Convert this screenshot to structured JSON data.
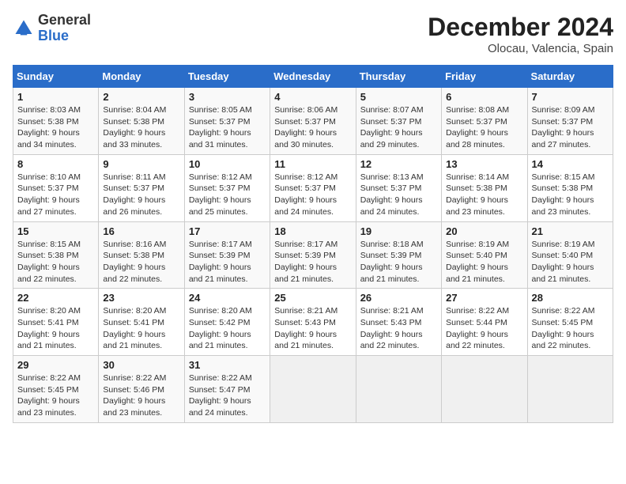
{
  "header": {
    "logo_general": "General",
    "logo_blue": "Blue",
    "title": "December 2024",
    "subtitle": "Olocau, Valencia, Spain"
  },
  "weekdays": [
    "Sunday",
    "Monday",
    "Tuesday",
    "Wednesday",
    "Thursday",
    "Friday",
    "Saturday"
  ],
  "weeks": [
    [
      {
        "day": "1",
        "sunrise": "8:03 AM",
        "sunset": "5:38 PM",
        "daylight": "9 hours and 34 minutes."
      },
      {
        "day": "2",
        "sunrise": "8:04 AM",
        "sunset": "5:38 PM",
        "daylight": "9 hours and 33 minutes."
      },
      {
        "day": "3",
        "sunrise": "8:05 AM",
        "sunset": "5:37 PM",
        "daylight": "9 hours and 31 minutes."
      },
      {
        "day": "4",
        "sunrise": "8:06 AM",
        "sunset": "5:37 PM",
        "daylight": "9 hours and 30 minutes."
      },
      {
        "day": "5",
        "sunrise": "8:07 AM",
        "sunset": "5:37 PM",
        "daylight": "9 hours and 29 minutes."
      },
      {
        "day": "6",
        "sunrise": "8:08 AM",
        "sunset": "5:37 PM",
        "daylight": "9 hours and 28 minutes."
      },
      {
        "day": "7",
        "sunrise": "8:09 AM",
        "sunset": "5:37 PM",
        "daylight": "9 hours and 27 minutes."
      }
    ],
    [
      {
        "day": "8",
        "sunrise": "8:10 AM",
        "sunset": "5:37 PM",
        "daylight": "9 hours and 27 minutes."
      },
      {
        "day": "9",
        "sunrise": "8:11 AM",
        "sunset": "5:37 PM",
        "daylight": "9 hours and 26 minutes."
      },
      {
        "day": "10",
        "sunrise": "8:12 AM",
        "sunset": "5:37 PM",
        "daylight": "9 hours and 25 minutes."
      },
      {
        "day": "11",
        "sunrise": "8:12 AM",
        "sunset": "5:37 PM",
        "daylight": "9 hours and 24 minutes."
      },
      {
        "day": "12",
        "sunrise": "8:13 AM",
        "sunset": "5:37 PM",
        "daylight": "9 hours and 24 minutes."
      },
      {
        "day": "13",
        "sunrise": "8:14 AM",
        "sunset": "5:38 PM",
        "daylight": "9 hours and 23 minutes."
      },
      {
        "day": "14",
        "sunrise": "8:15 AM",
        "sunset": "5:38 PM",
        "daylight": "9 hours and 23 minutes."
      }
    ],
    [
      {
        "day": "15",
        "sunrise": "8:15 AM",
        "sunset": "5:38 PM",
        "daylight": "9 hours and 22 minutes."
      },
      {
        "day": "16",
        "sunrise": "8:16 AM",
        "sunset": "5:38 PM",
        "daylight": "9 hours and 22 minutes."
      },
      {
        "day": "17",
        "sunrise": "8:17 AM",
        "sunset": "5:39 PM",
        "daylight": "9 hours and 21 minutes."
      },
      {
        "day": "18",
        "sunrise": "8:17 AM",
        "sunset": "5:39 PM",
        "daylight": "9 hours and 21 minutes."
      },
      {
        "day": "19",
        "sunrise": "8:18 AM",
        "sunset": "5:39 PM",
        "daylight": "9 hours and 21 minutes."
      },
      {
        "day": "20",
        "sunrise": "8:19 AM",
        "sunset": "5:40 PM",
        "daylight": "9 hours and 21 minutes."
      },
      {
        "day": "21",
        "sunrise": "8:19 AM",
        "sunset": "5:40 PM",
        "daylight": "9 hours and 21 minutes."
      }
    ],
    [
      {
        "day": "22",
        "sunrise": "8:20 AM",
        "sunset": "5:41 PM",
        "daylight": "9 hours and 21 minutes."
      },
      {
        "day": "23",
        "sunrise": "8:20 AM",
        "sunset": "5:41 PM",
        "daylight": "9 hours and 21 minutes."
      },
      {
        "day": "24",
        "sunrise": "8:20 AM",
        "sunset": "5:42 PM",
        "daylight": "9 hours and 21 minutes."
      },
      {
        "day": "25",
        "sunrise": "8:21 AM",
        "sunset": "5:43 PM",
        "daylight": "9 hours and 21 minutes."
      },
      {
        "day": "26",
        "sunrise": "8:21 AM",
        "sunset": "5:43 PM",
        "daylight": "9 hours and 22 minutes."
      },
      {
        "day": "27",
        "sunrise": "8:22 AM",
        "sunset": "5:44 PM",
        "daylight": "9 hours and 22 minutes."
      },
      {
        "day": "28",
        "sunrise": "8:22 AM",
        "sunset": "5:45 PM",
        "daylight": "9 hours and 22 minutes."
      }
    ],
    [
      {
        "day": "29",
        "sunrise": "8:22 AM",
        "sunset": "5:45 PM",
        "daylight": "9 hours and 23 minutes."
      },
      {
        "day": "30",
        "sunrise": "8:22 AM",
        "sunset": "5:46 PM",
        "daylight": "9 hours and 23 minutes."
      },
      {
        "day": "31",
        "sunrise": "8:22 AM",
        "sunset": "5:47 PM",
        "daylight": "9 hours and 24 minutes."
      },
      null,
      null,
      null,
      null
    ]
  ]
}
